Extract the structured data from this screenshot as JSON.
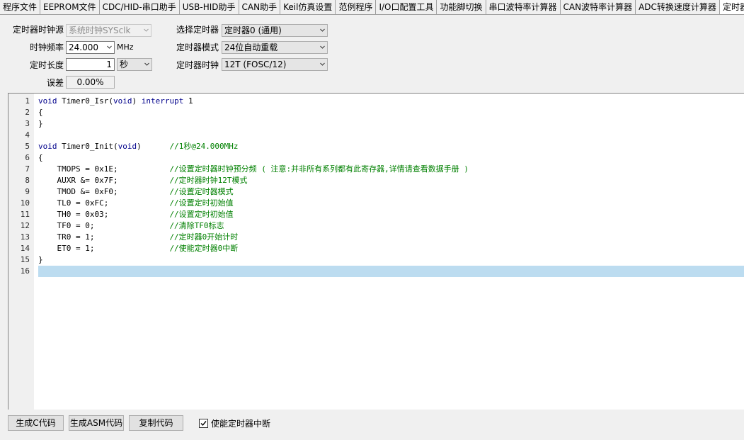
{
  "tabs": [
    {
      "label": "程序文件"
    },
    {
      "label": "EEPROM文件"
    },
    {
      "label": "CDC/HID-串口助手"
    },
    {
      "label": "USB-HID助手"
    },
    {
      "label": "CAN助手"
    },
    {
      "label": "Keil仿真设置"
    },
    {
      "label": "范例程序"
    },
    {
      "label": "I/O口配置工具"
    },
    {
      "label": "功能脚切换"
    },
    {
      "label": "串口波特率计算器"
    },
    {
      "label": "CAN波特率计算器"
    },
    {
      "label": "ADC转换速度计算器"
    },
    {
      "label": "定时器计"
    }
  ],
  "settings": {
    "clock_source_label": "定时器时钟源",
    "clock_source_value": "系统时钟SYSclk",
    "clock_freq_label": "时钟频率",
    "clock_freq_value": "24.000",
    "clock_freq_unit": "MHz",
    "duration_label": "定时长度",
    "duration_value": "1",
    "duration_unit": "秒",
    "error_label": "误差",
    "error_value": "0.00%",
    "timer_select_label": "选择定时器",
    "timer_select_value": "定时器0 (通用)",
    "timer_mode_label": "定时器模式",
    "timer_mode_value": "24位自动重载",
    "timer_clock_label": "定时器时钟",
    "timer_clock_value": "12T (FOSC/12)"
  },
  "editor": {
    "lines": [
      {
        "n": "1",
        "code": "void Timer0_Isr(void) interrupt 1",
        "comment": ""
      },
      {
        "n": "2",
        "code": "{",
        "comment": ""
      },
      {
        "n": "3",
        "code": "}",
        "comment": ""
      },
      {
        "n": "4",
        "code": "",
        "comment": ""
      },
      {
        "n": "5",
        "code": "void Timer0_Init(void)      ",
        "comment": "//1秒@24.000MHz"
      },
      {
        "n": "6",
        "code": "{",
        "comment": ""
      },
      {
        "n": "7",
        "code": "    TMOPS = 0x1E;           ",
        "comment": "//设置定时器时钟预分频 ( 注意:并非所有系列都有此寄存器,详情请查看数据手册 )"
      },
      {
        "n": "8",
        "code": "    AUXR &= 0x7F;           ",
        "comment": "//定时器时钟12T模式"
      },
      {
        "n": "9",
        "code": "    TMOD &= 0xF0;           ",
        "comment": "//设置定时器模式"
      },
      {
        "n": "10",
        "code": "    TL0 = 0xFC;             ",
        "comment": "//设置定时初始值"
      },
      {
        "n": "11",
        "code": "    TH0 = 0x03;             ",
        "comment": "//设置定时初始值"
      },
      {
        "n": "12",
        "code": "    TF0 = 0;                ",
        "comment": "//清除TF0标志"
      },
      {
        "n": "13",
        "code": "    TR0 = 1;                ",
        "comment": "//定时器0开始计时"
      },
      {
        "n": "14",
        "code": "    ET0 = 1;                ",
        "comment": "//使能定时器0中断"
      },
      {
        "n": "15",
        "code": "}",
        "comment": ""
      },
      {
        "n": "16",
        "code": "",
        "comment": ""
      }
    ]
  },
  "buttons": {
    "gen_c": "生成C代码",
    "gen_asm": "生成ASM代码",
    "copy": "复制代码"
  },
  "checkbox": {
    "label": "使能定时器中断",
    "checked": true
  }
}
